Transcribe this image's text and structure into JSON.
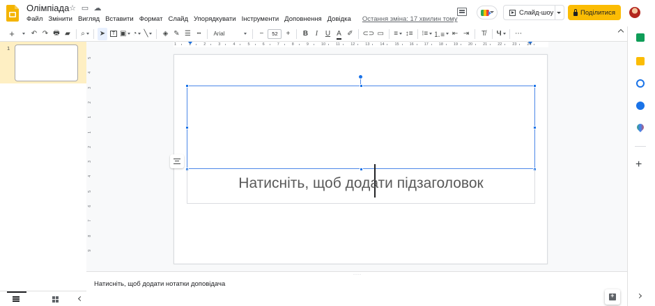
{
  "window": {
    "doc_title": "Олімпіада"
  },
  "menu": {
    "items": [
      "Файл",
      "Змінити",
      "Вигляд",
      "Вставити",
      "Формат",
      "Слайд",
      "Упорядкувати",
      "Інструменти",
      "Доповнення",
      "Довідка"
    ],
    "last_edit": "Остання зміна: 17 хвилин тому"
  },
  "header_actions": {
    "slideshow_label": "Слайд-шоу",
    "share_label": "Поділитися"
  },
  "toolbar": {
    "font_name": "Arial",
    "font_size": "52",
    "minus": "−",
    "plus": "+",
    "more": "⋯"
  },
  "filmstrip": {
    "slide_number": "1"
  },
  "slide": {
    "subtitle_placeholder": "Натисніть, щоб додати підзаголовок"
  },
  "notes": {
    "placeholder": "Натисніть, щоб додати нотатки доповідача"
  },
  "ruler": {
    "h_ticks": [
      "1",
      "1",
      "2",
      "3",
      "4",
      "5",
      "6",
      "7",
      "8",
      "9",
      "10",
      "11",
      "12",
      "13",
      "14",
      "15",
      "16",
      "17",
      "18",
      "19",
      "20",
      "21",
      "22",
      "23",
      "24"
    ],
    "v_ticks": [
      "5",
      "4",
      "3",
      "2",
      "1",
      "1",
      "2",
      "3",
      "4",
      "5",
      "6",
      "7",
      "8",
      "9"
    ]
  },
  "colors": {
    "accent": "#1a73e8",
    "share_button": "#fbbc04",
    "selection": "#4a86e8"
  }
}
